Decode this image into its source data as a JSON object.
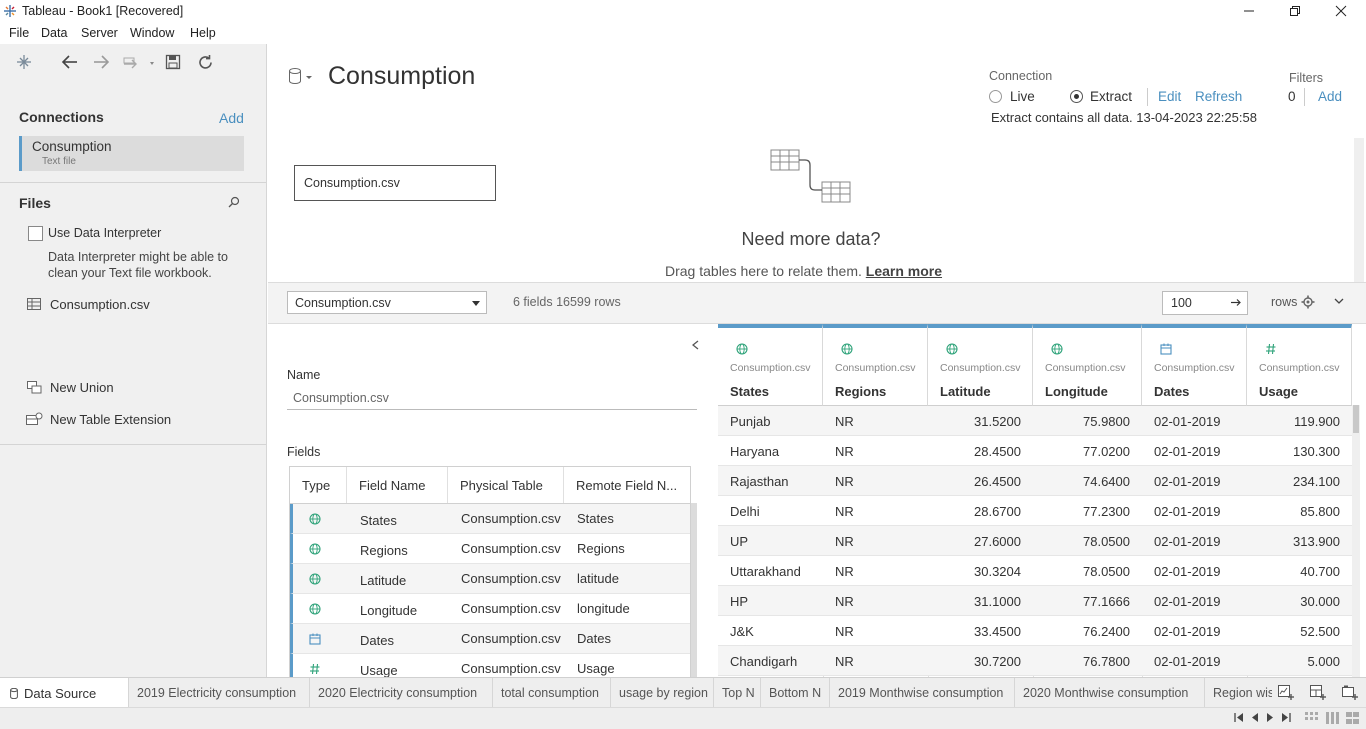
{
  "window": {
    "title": "Tableau - Book1 [Recovered]"
  },
  "menu": [
    "File",
    "Data",
    "Server",
    "Window",
    "Help"
  ],
  "left": {
    "connections_title": "Connections",
    "add_label": "Add",
    "connection": {
      "name": "Consumption",
      "type": "Text file"
    },
    "files_title": "Files",
    "use_interpreter": "Use Data Interpreter",
    "interpreter_note_1": "Data Interpreter might be able to",
    "interpreter_note_2": "clean your Text file workbook.",
    "file_item": "Consumption.csv",
    "new_union": "New Union",
    "new_table_extension": "New Table Extension"
  },
  "datasource": {
    "name": "Consumption",
    "connection_label": "Connection",
    "live": "Live",
    "extract": "Extract",
    "selected_connection": "Extract",
    "edit": "Edit",
    "refresh": "Refresh",
    "extract_info": "Extract contains all data. 13-04-2023 22:25:58",
    "filters_label": "Filters",
    "filters_count": "0",
    "filters_add": "Add",
    "canvas_table": "Consumption.csv",
    "need_more": "Need more data?",
    "drag_hint": "Drag tables here to relate them.",
    "learn_more": "Learn more"
  },
  "gridbar": {
    "table_select": "Consumption.csv",
    "summary": "6 fields 16599 rows",
    "rows_value": "100",
    "rows_label": "rows"
  },
  "meta": {
    "name_label": "Name",
    "name_value": "Consumption.csv",
    "fields_label": "Fields",
    "headers": [
      "Type",
      "Field Name",
      "Physical Table",
      "Remote Field N..."
    ],
    "rows": [
      {
        "type": "globe-icon",
        "field": "States",
        "table": "Consumption.csv",
        "remote": "States"
      },
      {
        "type": "globe-icon",
        "field": "Regions",
        "table": "Consumption.csv",
        "remote": "Regions"
      },
      {
        "type": "globe-icon",
        "field": "Latitude",
        "table": "Consumption.csv",
        "remote": "latitude"
      },
      {
        "type": "globe-icon",
        "field": "Longitude",
        "table": "Consumption.csv",
        "remote": "longitude"
      },
      {
        "type": "calendar-icon",
        "field": "Dates",
        "table": "Consumption.csv",
        "remote": "Dates"
      },
      {
        "type": "number-icon",
        "field": "Usage",
        "table": "Consumption.csv",
        "remote": "Usage"
      }
    ]
  },
  "grid": {
    "columns": [
      {
        "source": "Consumption.csv",
        "name": "States",
        "icon": "globe-icon"
      },
      {
        "source": "Consumption.csv",
        "name": "Regions",
        "icon": "globe-icon"
      },
      {
        "source": "Consumption.csv",
        "name": "Latitude",
        "icon": "globe-icon"
      },
      {
        "source": "Consumption.csv",
        "name": "Longitude",
        "icon": "globe-icon"
      },
      {
        "source": "Consumption.csv",
        "name": "Dates",
        "icon": "calendar-icon"
      },
      {
        "source": "Consumption.csv",
        "name": "Usage",
        "icon": "number-icon"
      }
    ],
    "rows": [
      [
        "Punjab",
        "NR",
        "31.5200",
        "75.9800",
        "02-01-2019",
        "119.900"
      ],
      [
        "Haryana",
        "NR",
        "28.4500",
        "77.0200",
        "02-01-2019",
        "130.300"
      ],
      [
        "Rajasthan",
        "NR",
        "26.4500",
        "74.6400",
        "02-01-2019",
        "234.100"
      ],
      [
        "Delhi",
        "NR",
        "28.6700",
        "77.2300",
        "02-01-2019",
        "85.800"
      ],
      [
        "UP",
        "NR",
        "27.6000",
        "78.0500",
        "02-01-2019",
        "313.900"
      ],
      [
        "Uttarakhand",
        "NR",
        "30.3204",
        "78.0500",
        "02-01-2019",
        "40.700"
      ],
      [
        "HP",
        "NR",
        "31.1000",
        "77.1666",
        "02-01-2019",
        "30.000"
      ],
      [
        "J&K",
        "NR",
        "33.4500",
        "76.2400",
        "02-01-2019",
        "52.500"
      ],
      [
        "Chandigarh",
        "NR",
        "30.7200",
        "76.7800",
        "02-01-2019",
        "5.000"
      ]
    ]
  },
  "tabs": [
    "Data Source",
    "2019 Electricity consumption",
    "2020 Electricity consumption",
    "total consumption",
    "usage by region",
    "Top N",
    "Bottom N",
    "2019 Monthwise consumption",
    "2020 Monthwise consumption",
    "Region wis"
  ],
  "colors": {
    "accent": "#5b9bc9",
    "link": "#4a8fbf",
    "geo_icon": "#2fa37a",
    "selected_tab": "#ffffff"
  }
}
